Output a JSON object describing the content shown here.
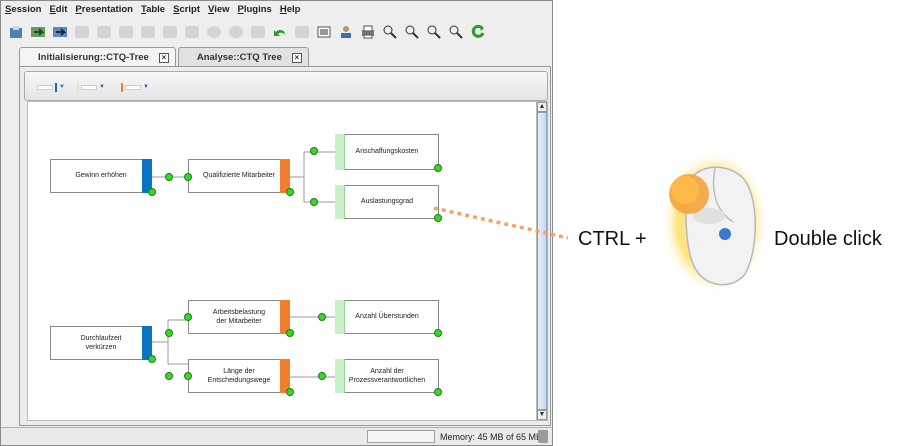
{
  "menubar": [
    {
      "underline": "S",
      "rest": "ession"
    },
    {
      "underline": "E",
      "rest": "dit"
    },
    {
      "underline": "P",
      "rest": "resentation"
    },
    {
      "underline": "T",
      "rest": "able"
    },
    {
      "underline": "S",
      "rest": "cript"
    },
    {
      "underline": "V",
      "rest": "iew"
    },
    {
      "underline": "P",
      "rest": "lugins"
    },
    {
      "underline": "H",
      "rest": "elp"
    }
  ],
  "tabs": [
    {
      "label": "Initialisierung::CTQ-Tree",
      "close": "×"
    },
    {
      "label": "Analyse::CTQ Tree",
      "close": "×"
    }
  ],
  "tree": {
    "group1": {
      "root": "Gewinn erhöhen",
      "mid": "Qualifizierte Mitarbeiter",
      "leaf1": "Anschaffungskosten",
      "leaf2": "Auslastungsgrad"
    },
    "group2": {
      "root_line1": "Durchlaufzeit",
      "root_line2": "verkürzen",
      "mid1_line1": "Arbeitsbelastung",
      "mid1_line2": "der Mitarbeiter",
      "mid2_line1": "Länge der",
      "mid2_line2": "Entscheidungswege",
      "leaf1": "Anzahl Überstunden",
      "leaf2_line1": "Anzahl der",
      "leaf2_line2": "Prozessverantwortlichen"
    }
  },
  "status": {
    "memory": "Memory: 45 MB of 65 MB"
  },
  "annotation": {
    "ctrl": "CTRL +",
    "action": "Double click"
  },
  "colors": {
    "blue": "#0a74c4",
    "orange": "#f07e2c",
    "green_dot": "#38d82a",
    "dashed_line": "#f4a46a"
  }
}
